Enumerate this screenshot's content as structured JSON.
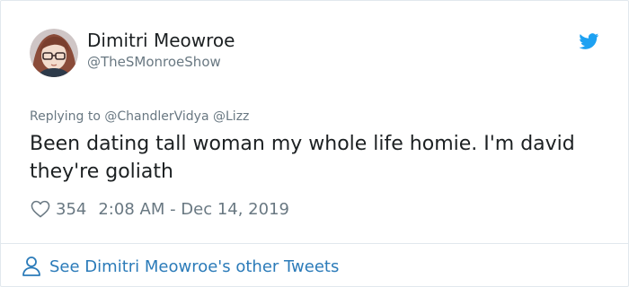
{
  "author": {
    "display_name": "Dimitri Meowroe",
    "handle": "@TheSMonroeShow"
  },
  "reply": {
    "prefix": "Replying to",
    "mentions": [
      "@ChandlerVidya",
      "@Lizz"
    ]
  },
  "tweet": {
    "text": "Been dating tall woman my whole life homie. I'm david they're goliath"
  },
  "meta": {
    "likes": "354",
    "timestamp": "2:08 AM - Dec 14, 2019"
  },
  "footer": {
    "see_more_label": "See Dimitri Meowroe's other Tweets"
  },
  "icons": {
    "brand": "twitter-bird-icon",
    "like": "heart-icon",
    "profile": "person-icon"
  },
  "colors": {
    "twitter_blue": "#1da1f2",
    "link_blue": "#2b7bb9",
    "muted_text": "#697882",
    "primary_text": "#1c2022",
    "border": "#e1e8ed"
  }
}
